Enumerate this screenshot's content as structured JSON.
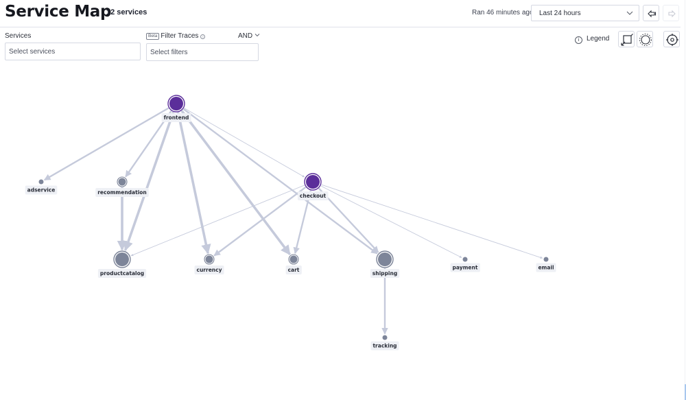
{
  "header": {
    "title": "Service Map",
    "service_count": "12 services",
    "ran_text": "Ran 46 minutes ago",
    "time_range": "Last 24 hours",
    "back_icon": "arrow-left-icon",
    "forward_icon": "arrow-right-icon"
  },
  "filters": {
    "services_label": "Services",
    "services_placeholder": "Select services",
    "beta_badge": "Beta",
    "traces_label": "Filter Traces",
    "traces_placeholder": "Select filters",
    "operator": "AND"
  },
  "toolbar": {
    "legend_label": "Legend",
    "fit_icon": "fit-to-screen-icon",
    "layout_icon": "radial-layout-icon",
    "center_icon": "center-target-icon"
  },
  "colors": {
    "root_node": "#5b2e9a",
    "service_node": "#7d8599",
    "edge": "#c5cadb"
  },
  "graph": {
    "nodes": [
      {
        "id": "frontend",
        "label": "frontend",
        "kind": "root",
        "size": "large"
      },
      {
        "id": "checkout",
        "label": "checkout",
        "kind": "root",
        "size": "large"
      },
      {
        "id": "adservice",
        "label": "adservice",
        "kind": "leaf",
        "size": "small"
      },
      {
        "id": "recommendation",
        "label": "recommendation",
        "kind": "service",
        "size": "medium"
      },
      {
        "id": "productcatalog",
        "label": "productcatalog",
        "kind": "service",
        "size": "large"
      },
      {
        "id": "currency",
        "label": "currency",
        "kind": "service",
        "size": "medium"
      },
      {
        "id": "cart",
        "label": "cart",
        "kind": "service",
        "size": "medium"
      },
      {
        "id": "shipping",
        "label": "shipping",
        "kind": "service",
        "size": "large"
      },
      {
        "id": "payment",
        "label": "payment",
        "kind": "leaf",
        "size": "small"
      },
      {
        "id": "email",
        "label": "email",
        "kind": "leaf",
        "size": "small"
      },
      {
        "id": "tracking",
        "label": "tracking",
        "kind": "leaf",
        "size": "small"
      }
    ],
    "edges": [
      {
        "from": "frontend",
        "to": "adservice",
        "weight": "medium"
      },
      {
        "from": "frontend",
        "to": "recommendation",
        "weight": "medium"
      },
      {
        "from": "frontend",
        "to": "productcatalog",
        "weight": "heavy"
      },
      {
        "from": "frontend",
        "to": "currency",
        "weight": "heavy"
      },
      {
        "from": "frontend",
        "to": "cart",
        "weight": "heavy"
      },
      {
        "from": "frontend",
        "to": "shipping",
        "weight": "medium"
      },
      {
        "from": "frontend",
        "to": "checkout",
        "weight": "light"
      },
      {
        "from": "recommendation",
        "to": "productcatalog",
        "weight": "heavy"
      },
      {
        "from": "checkout",
        "to": "productcatalog",
        "weight": "light"
      },
      {
        "from": "checkout",
        "to": "currency",
        "weight": "medium"
      },
      {
        "from": "checkout",
        "to": "cart",
        "weight": "medium"
      },
      {
        "from": "checkout",
        "to": "shipping",
        "weight": "medium"
      },
      {
        "from": "checkout",
        "to": "payment",
        "weight": "light"
      },
      {
        "from": "checkout",
        "to": "email",
        "weight": "light"
      },
      {
        "from": "shipping",
        "to": "tracking",
        "weight": "medium"
      }
    ]
  }
}
